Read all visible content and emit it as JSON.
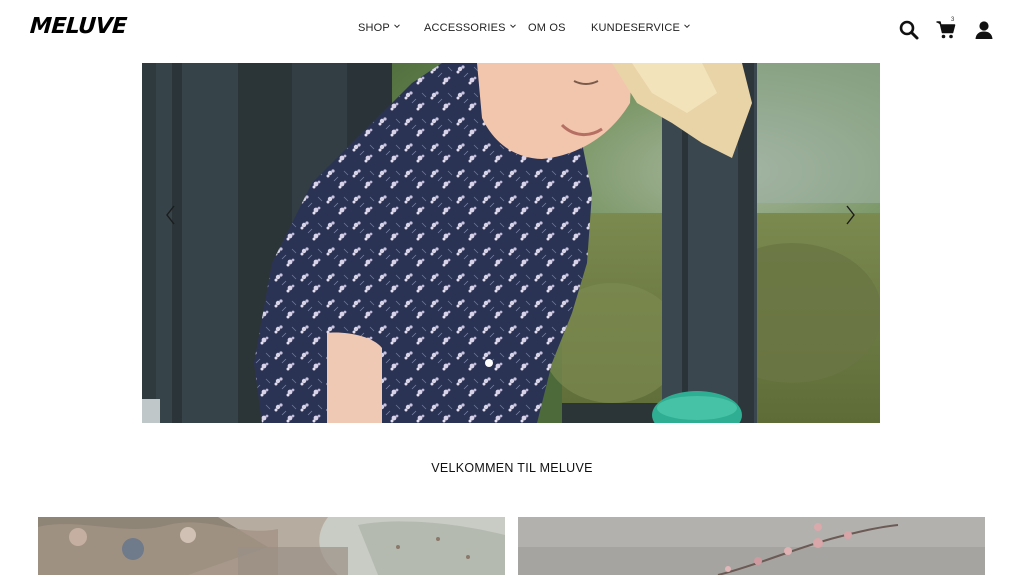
{
  "brand": {
    "logo_text": "MELUVE"
  },
  "nav": {
    "items": [
      {
        "label": "SHOP",
        "has_dropdown": true
      },
      {
        "label": "ACCESSORIES",
        "has_dropdown": true
      },
      {
        "label": "OM OS",
        "has_dropdown": false
      },
      {
        "label": "KUNDESERVICE",
        "has_dropdown": true
      }
    ]
  },
  "header_icons": {
    "search": "search-icon",
    "cart": "cart-icon",
    "account": "user-icon",
    "cart_count": "3"
  },
  "hero": {
    "image": "child-in-floral-dress-on-playground",
    "prev": "chevron-left-icon",
    "next": "chevron-right-icon",
    "slides_total": 1,
    "slide_active": 1
  },
  "welcome": {
    "heading": "VELKOMMEN TIL MELUVE"
  },
  "tiles": [
    {
      "image": "floral-fabric-clothing"
    },
    {
      "image": "blossom-branch"
    }
  ],
  "colors": {
    "text": "#111111",
    "background": "#ffffff"
  }
}
